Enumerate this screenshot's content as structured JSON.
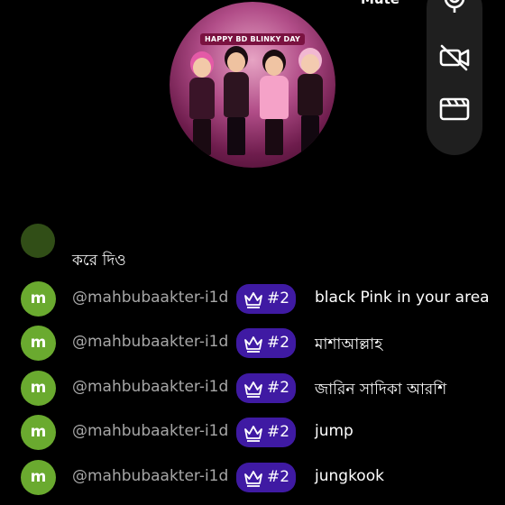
{
  "header": {
    "mute_label": "Mute",
    "avatar_banner": "HAPPY BD BLINKY DAY"
  },
  "toolbar": {
    "items": [
      {
        "icon": "microphone-icon"
      },
      {
        "icon": "video-off-icon"
      },
      {
        "icon": "clapperboard-icon"
      }
    ]
  },
  "chat": {
    "partial_message": "করে দিও",
    "messages": [
      {
        "avatar_letter": "m",
        "handle": "@mahbubaakter-i1d",
        "rank": "#2",
        "text": "black Pink in your area"
      },
      {
        "avatar_letter": "m",
        "handle": "@mahbubaakter-i1d",
        "rank": "#2",
        "text": "মাশাআল্লাহ"
      },
      {
        "avatar_letter": "m",
        "handle": "@mahbubaakter-i1d",
        "rank": "#2",
        "text": "জারিন সাদিকা আরশি"
      },
      {
        "avatar_letter": "m",
        "handle": "@mahbubaakter-i1d",
        "rank": "#2",
        "text": "jump"
      },
      {
        "avatar_letter": "m",
        "handle": "@mahbubaakter-i1d",
        "rank": "#2",
        "text": "jungkook"
      }
    ]
  },
  "colors": {
    "background": "#000000",
    "avatar_green": "#6aaa2f",
    "badge_purple": "#3f1aa3",
    "handle_gray": "#a7a7a7",
    "toolbar_bg": "#1f1f1f"
  }
}
